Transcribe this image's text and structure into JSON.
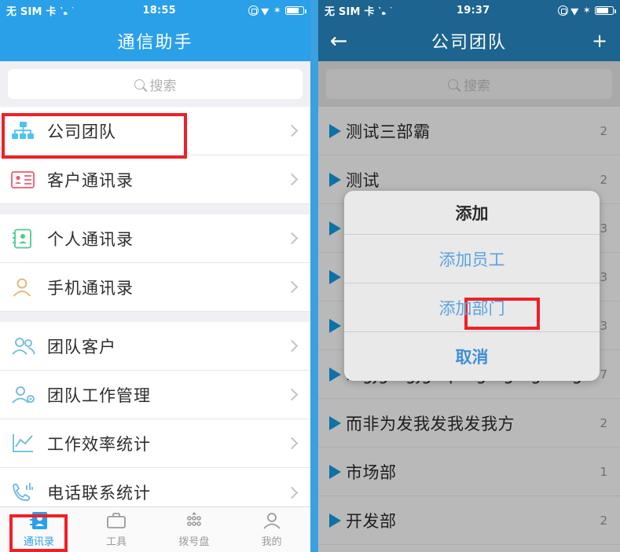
{
  "left_phone": {
    "status_bar": {
      "carrier": "无 SIM 卡",
      "time": "18:55",
      "icons": [
        "wifi-icon",
        "rotation-lock-icon",
        "location-arrow-icon",
        "bluetooth-icon",
        "battery-icon"
      ]
    },
    "nav": {
      "title": "通信助手"
    },
    "search": {
      "placeholder": "搜索",
      "icon": "search-icon"
    },
    "groups": [
      {
        "items": [
          {
            "label": "公司团队",
            "icon": "org-chart-icon",
            "chevron": "chevron-right-icon",
            "highlighted": true
          },
          {
            "label": "客户通讯录",
            "icon": "id-card-icon",
            "chevron": "chevron-right-icon",
            "highlighted": false
          }
        ]
      },
      {
        "items": [
          {
            "label": "个人通讯录",
            "icon": "contact-book-icon",
            "chevron": "chevron-right-icon",
            "highlighted": false
          },
          {
            "label": "手机通讯录",
            "icon": "person-icon",
            "chevron": "chevron-right-icon",
            "highlighted": false
          }
        ]
      },
      {
        "items": [
          {
            "label": "团队客户",
            "icon": "group-icon",
            "chevron": "chevron-right-icon",
            "highlighted": false
          },
          {
            "label": "团队工作管理",
            "icon": "person-gear-icon",
            "chevron": "chevron-right-icon",
            "highlighted": false
          },
          {
            "label": "工作效率统计",
            "icon": "line-chart-icon",
            "chevron": "chevron-right-icon",
            "highlighted": false
          },
          {
            "label": "电话联系统计",
            "icon": "phone-signal-icon",
            "chevron": "chevron-right-icon",
            "highlighted": false
          }
        ]
      }
    ],
    "tabs": [
      {
        "label": "通讯录",
        "icon": "contacts-icon",
        "active": true
      },
      {
        "label": "工具",
        "icon": "briefcase-icon",
        "active": false
      },
      {
        "label": "拨号盘",
        "icon": "dialpad-icon",
        "active": false
      },
      {
        "label": "我的",
        "icon": "profile-icon",
        "active": false
      }
    ]
  },
  "right_phone": {
    "status_bar": {
      "carrier": "无 SIM 卡",
      "time": "19:37",
      "icons": [
        "wifi-icon",
        "rotation-lock-icon",
        "location-arrow-icon",
        "bluetooth-icon",
        "battery-icon"
      ]
    },
    "nav": {
      "back": "←",
      "title": "公司团队",
      "add": "+"
    },
    "search": {
      "placeholder": "搜索",
      "icon": "search-icon"
    },
    "rows": [
      {
        "label": "测试三部霸",
        "count": "2"
      },
      {
        "label": "测试",
        "count": "2"
      },
      {
        "label": "",
        "count": "3"
      },
      {
        "label": "",
        "count": "3"
      },
      {
        "label": "",
        "count": "3"
      },
      {
        "label": "mgjgmgjgmpmgmgmgmwgk",
        "count": "7"
      },
      {
        "label": "而非为发我发我发我方",
        "count": "2"
      },
      {
        "label": "市场部",
        "count": "1"
      },
      {
        "label": "开发部",
        "count": "2"
      }
    ],
    "modal": {
      "title": "添加",
      "options": [
        {
          "label": "添加员工",
          "highlighted": true
        },
        {
          "label": "添加部门",
          "highlighted": false
        }
      ],
      "cancel": "取消"
    }
  },
  "colors": {
    "brand_blue": "#2aa0e8",
    "dim_blue": "#1d6490",
    "highlight_red": "#f02027",
    "link_blue": "#5aa3e0",
    "triangle_blue": "#0d72a8"
  }
}
